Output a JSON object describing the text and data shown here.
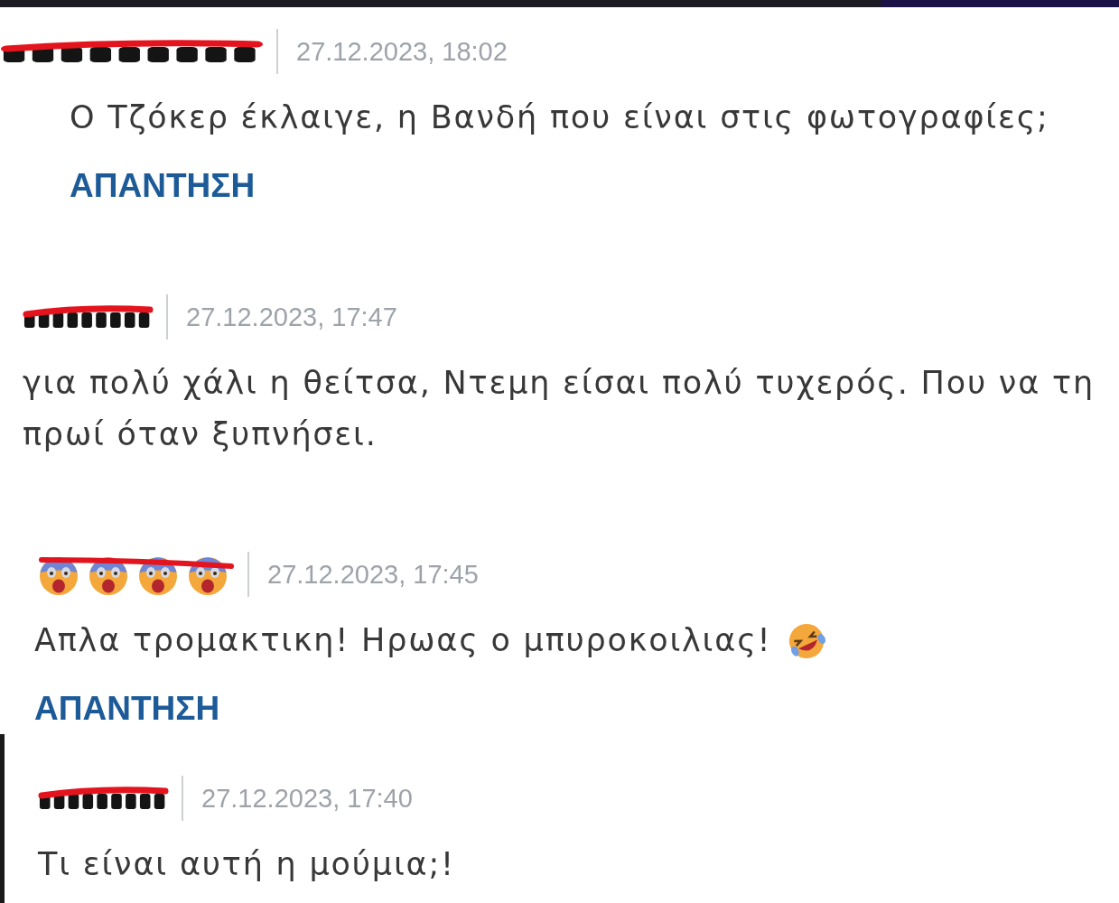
{
  "comments": [
    {
      "author": {
        "kind": "text"
      },
      "date": "27.12.2023, 18:02",
      "body_lines": [
        "Ο Τζόκερ έκλαιγε, η Βανδή που είναι στις φωτογραφίες;"
      ],
      "reply_label": "ΑΠΑΝΤΗΣΗ"
    },
    {
      "author": {
        "kind": "text"
      },
      "date": "27.12.2023, 17:47",
      "body_lines": [
        "για πολύ χάλι η θείτσα, Ντεμη είσαι πολύ τυχερός. Που να τη",
        "πρωί όταν ξυπνήσει."
      ]
    },
    {
      "author": {
        "kind": "emoji"
      },
      "date": "27.12.2023, 17:45",
      "body_lines": [
        "Απλα τρομακτικη! Ηρωας ο μπυροκοιλιας!"
      ],
      "body_emoji": true,
      "reply_label": "ΑΠΑΝΤΗΣΗ",
      "children": [
        {
          "author": {
            "kind": "text"
          },
          "date": "27.12.2023, 17:40",
          "body_lines": [
            "Τι είναι αυτή η μούμια;!"
          ]
        }
      ]
    }
  ]
}
